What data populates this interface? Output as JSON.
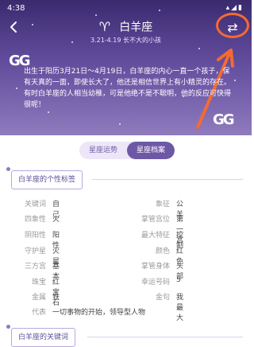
{
  "status": {
    "time": "4:38",
    "icons": "▴◢▮"
  },
  "header": {
    "sign_glyph": "♈",
    "title": "白羊座",
    "subtitle": "3.21-4.19 长不大的小孩",
    "back_icon": "‹",
    "switch_icon": "⇄"
  },
  "hero": {
    "quote_open": "GG",
    "quote_close": "GG",
    "description": "出生于阳历3月21日～4月19日，白羊座的内心一直一个孩子，保有天真的一面，即使长大了，他还是相信世界上有小精灵的存在。有时白羊座的人相当幼稚，可是他绝不是不聪明，他的反应可快得很呢！"
  },
  "tabs": {
    "trend": "星座运势",
    "profile": "星座档案"
  },
  "sections": {
    "tags_title": "白羊座的个性标签",
    "keywords_title": "白羊座的关键词"
  },
  "profile_left": [
    {
      "label": "关键词",
      "value": "自己"
    },
    {
      "label": "四象性",
      "value": "火"
    },
    {
      "label": "阴阳性",
      "value": "阳性"
    },
    {
      "label": "守护星",
      "value": "火星"
    },
    {
      "label": "三方宫",
      "value": "基本"
    },
    {
      "label": "珠宝",
      "value": "红宝石"
    },
    {
      "label": "金属",
      "value": "铁"
    }
  ],
  "profile_right": [
    {
      "label": "象征",
      "value": "公羊"
    },
    {
      "label": "掌管宫位",
      "value": "第一宫"
    },
    {
      "label": "最大特征",
      "value": "控制"
    },
    {
      "label": "颜色",
      "value": "红色"
    },
    {
      "label": "掌管身体",
      "value": "头部"
    },
    {
      "label": "幸运号码",
      "value": "5"
    },
    {
      "label": "金句",
      "value": "我最大"
    }
  ],
  "represent": {
    "label": "代表",
    "value": "一切事物的开始，领导型人物"
  },
  "colors": {
    "accent": "#6d58a6",
    "annotation": "#f56a32"
  }
}
